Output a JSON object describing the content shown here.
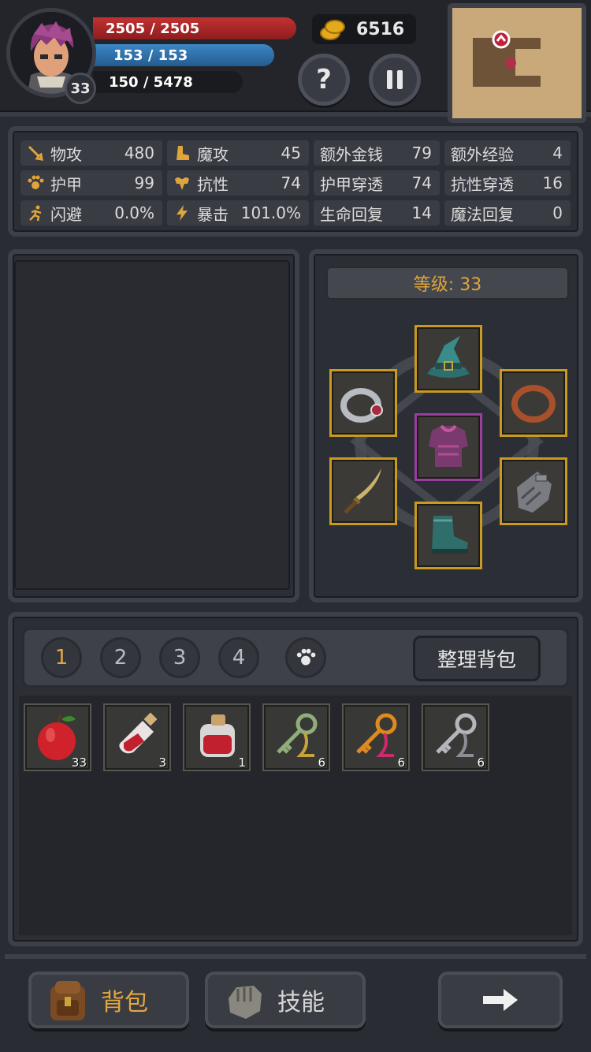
{
  "player": {
    "hp": "2505 / 2505",
    "mp": "153 / 153",
    "xp": "150 / 5478",
    "level": "33",
    "hp_fraction": 1.0,
    "mp_fraction": 1.0,
    "xp_fraction": 0.027
  },
  "gold": "6516",
  "buttons": {
    "help": "?"
  },
  "stats": [
    {
      "icon": "sword-icon",
      "label": "物攻",
      "value": "480"
    },
    {
      "icon": "magic-boot-icon",
      "label": "魔攻",
      "value": "45"
    },
    {
      "icon": "",
      "label": "额外金钱",
      "value": "79"
    },
    {
      "icon": "",
      "label": "额外经验",
      "value": "4"
    },
    {
      "icon": "paw-icon",
      "label": "护甲",
      "value": "99"
    },
    {
      "icon": "muscle-icon",
      "label": "抗性",
      "value": "74"
    },
    {
      "icon": "",
      "label": "护甲穿透",
      "value": "74"
    },
    {
      "icon": "",
      "label": "抗性穿透",
      "value": "16"
    },
    {
      "icon": "running-icon",
      "label": "闪避",
      "value": "0.0%"
    },
    {
      "icon": "lightning-icon",
      "label": "暴击",
      "value": "101.0%"
    },
    {
      "icon": "",
      "label": "生命回复",
      "value": "14"
    },
    {
      "icon": "",
      "label": "魔法回复",
      "value": "0"
    }
  ],
  "equipment": {
    "level_label": "等级: 33",
    "slots": [
      "hat",
      "ring-left",
      "ring-right",
      "chest",
      "weapon",
      "gloves",
      "boots"
    ]
  },
  "bag": {
    "pages": [
      "1",
      "2",
      "3",
      "4"
    ],
    "active_page": "1",
    "sort_label": "整理背包",
    "items": [
      {
        "icon": "apple-icon",
        "count": "33"
      },
      {
        "icon": "potion-small-icon",
        "count": "3"
      },
      {
        "icon": "potion-large-icon",
        "count": "1"
      },
      {
        "icon": "green-key-icon",
        "count": "6"
      },
      {
        "icon": "orange-key-icon",
        "count": "6"
      },
      {
        "icon": "silver-key-icon",
        "count": "6"
      }
    ]
  },
  "footer": {
    "bag_label": "背包",
    "skill_label": "技能"
  },
  "colors": {
    "hp": "#c23232",
    "mp": "#3c86c4",
    "gold": "#e4a91c",
    "accent": "#e5a63e",
    "slot_border": "#c99a20",
    "chest_border": "#9a3ca0"
  }
}
